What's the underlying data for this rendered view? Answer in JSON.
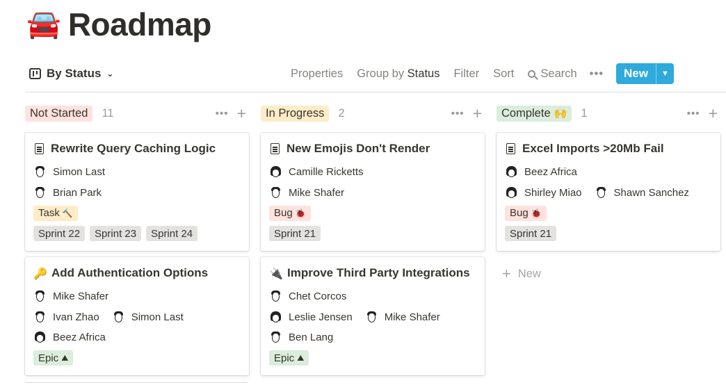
{
  "page": {
    "icon": "🚘",
    "icon_name": "car-icon",
    "title": "Roadmap"
  },
  "toolbar": {
    "view_label": "By Status",
    "properties": "Properties",
    "group_by_prefix": "Group by",
    "group_by_value": "Status",
    "filter": "Filter",
    "sort": "Sort",
    "search": "Search",
    "more": "•••",
    "new_label": "New",
    "new_dropdown": "▼",
    "accent": "#2eaadc"
  },
  "columns": [
    {
      "name": "Not Started",
      "count": "11",
      "color": "#ffe2dd",
      "cards": [
        {
          "title": "Rewrite Query Caching Logic",
          "icon": "page",
          "people": [
            [
              {
                "name": "Simon Last"
              }
            ],
            [
              {
                "name": "Brian Park"
              }
            ]
          ],
          "type_tag": {
            "label": "Task",
            "emoji": "🔨",
            "color": "#fdecc8"
          },
          "sprints": [
            "Sprint 22",
            "Sprint 23",
            "Sprint 24"
          ]
        },
        {
          "title": "Add Authentication Options",
          "icon": "🔑",
          "people": [
            [
              {
                "name": "Mike Shafer"
              }
            ],
            [
              {
                "name": "Ivan Zhao"
              },
              {
                "name": "Simon Last"
              }
            ],
            [
              {
                "name": "Beez Africa"
              }
            ]
          ],
          "type_tag": {
            "label": "Epic",
            "emoji": "⛰",
            "color": "#dbeddb"
          },
          "sprints": []
        }
      ]
    },
    {
      "name": "In Progress",
      "count": "2",
      "color": "#fdecc8",
      "cards": [
        {
          "title": "New Emojis Don't Render",
          "icon": "page",
          "people": [
            [
              {
                "name": "Camille Ricketts"
              }
            ],
            [
              {
                "name": "Mike Shafer"
              }
            ]
          ],
          "type_tag": {
            "label": "Bug",
            "emoji": "🐞",
            "color": "#ffe2dd"
          },
          "sprints": [
            "Sprint 21"
          ]
        },
        {
          "title": "Improve Third Party Integrations",
          "icon": "🔌",
          "people": [
            [
              {
                "name": "Chet Corcos"
              }
            ],
            [
              {
                "name": "Leslie Jensen"
              },
              {
                "name": "Mike Shafer"
              }
            ],
            [
              {
                "name": "Ben Lang"
              }
            ]
          ],
          "type_tag": {
            "label": "Epic",
            "emoji": "⛰",
            "color": "#dbeddb"
          },
          "sprints": []
        }
      ]
    },
    {
      "name": "Complete",
      "emoji": "🙌",
      "count": "1",
      "color": "#dbeddb",
      "cards": [
        {
          "title": "Excel Imports >20Mb Fail",
          "icon": "page",
          "people": [
            [
              {
                "name": "Beez Africa"
              }
            ],
            [
              {
                "name": "Shirley Miao"
              },
              {
                "name": "Shawn Sanchez"
              }
            ]
          ],
          "type_tag": {
            "label": "Bug",
            "emoji": "🐞",
            "color": "#ffe2dd"
          },
          "sprints": [
            "Sprint 21"
          ]
        }
      ],
      "add_new": "New"
    }
  ],
  "sprint_tag_color": "#e3e2e0"
}
